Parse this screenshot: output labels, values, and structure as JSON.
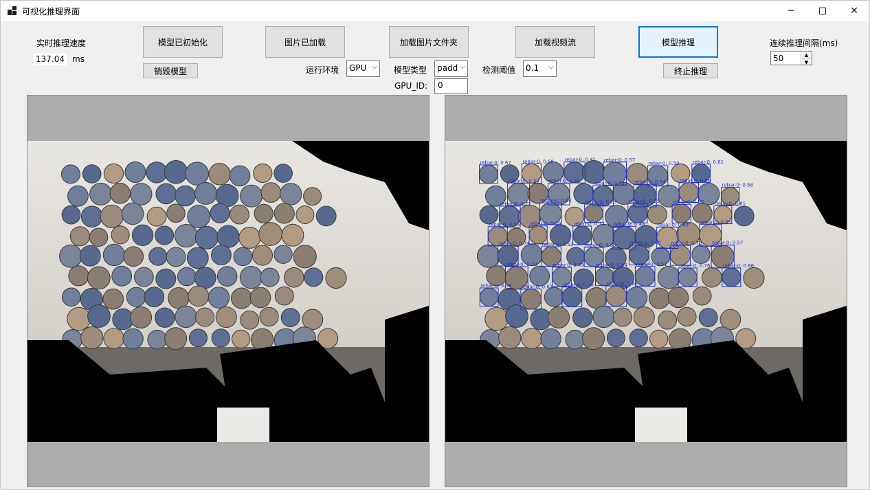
{
  "window": {
    "title": "可视化推理界面",
    "icon": "app-icon",
    "controls": {
      "minimize": "─",
      "close": "✕"
    }
  },
  "speed": {
    "label": "实时推理速度",
    "value": "137.04",
    "unit": "ms"
  },
  "buttons": {
    "init_model": "模型已初始化",
    "destroy_model": "销毁模型",
    "image_loaded": "图片已加载",
    "load_folder": "加载图片文件夹",
    "load_video": "加载视频流",
    "infer": "模型推理",
    "stop_infer": "终止推理"
  },
  "env": {
    "label": "运行环境",
    "value": "GPU"
  },
  "model_type": {
    "label": "模型类型",
    "value": "padd"
  },
  "gpu_id": {
    "label": "GPU_ID:",
    "value": "0"
  },
  "threshold": {
    "label": "检测阈值",
    "value": "0.1"
  },
  "interval": {
    "label": "连续推理间隔(ms)",
    "value": "50"
  },
  "detections": {
    "class_name": "rebar-0",
    "box_color": "#1e2fd0",
    "scores": [
      "0.67",
      "0.68",
      "0.41",
      "0.57",
      "0.50",
      "0.61",
      "0.53",
      "0.44",
      "0.71",
      "0.54",
      "0.66",
      "0.58",
      "0.77",
      "0.64",
      "0.73",
      "0.59",
      "0.62",
      "0.81",
      "0.56",
      "0.69",
      "0.72",
      "0.48",
      "0.63",
      "0.55",
      "0.74",
      "0.52",
      "0.65",
      "0.60",
      "0.79",
      "0.57",
      "0.70",
      "0.49",
      "0.84",
      "0.51",
      "0.76",
      "0.66",
      "0.58",
      "0.62",
      "0.45",
      "0.68"
    ]
  },
  "colors": {
    "accent": "#0078d7",
    "panel_bg": "#acacac",
    "window_bg": "#f0f0f0"
  }
}
